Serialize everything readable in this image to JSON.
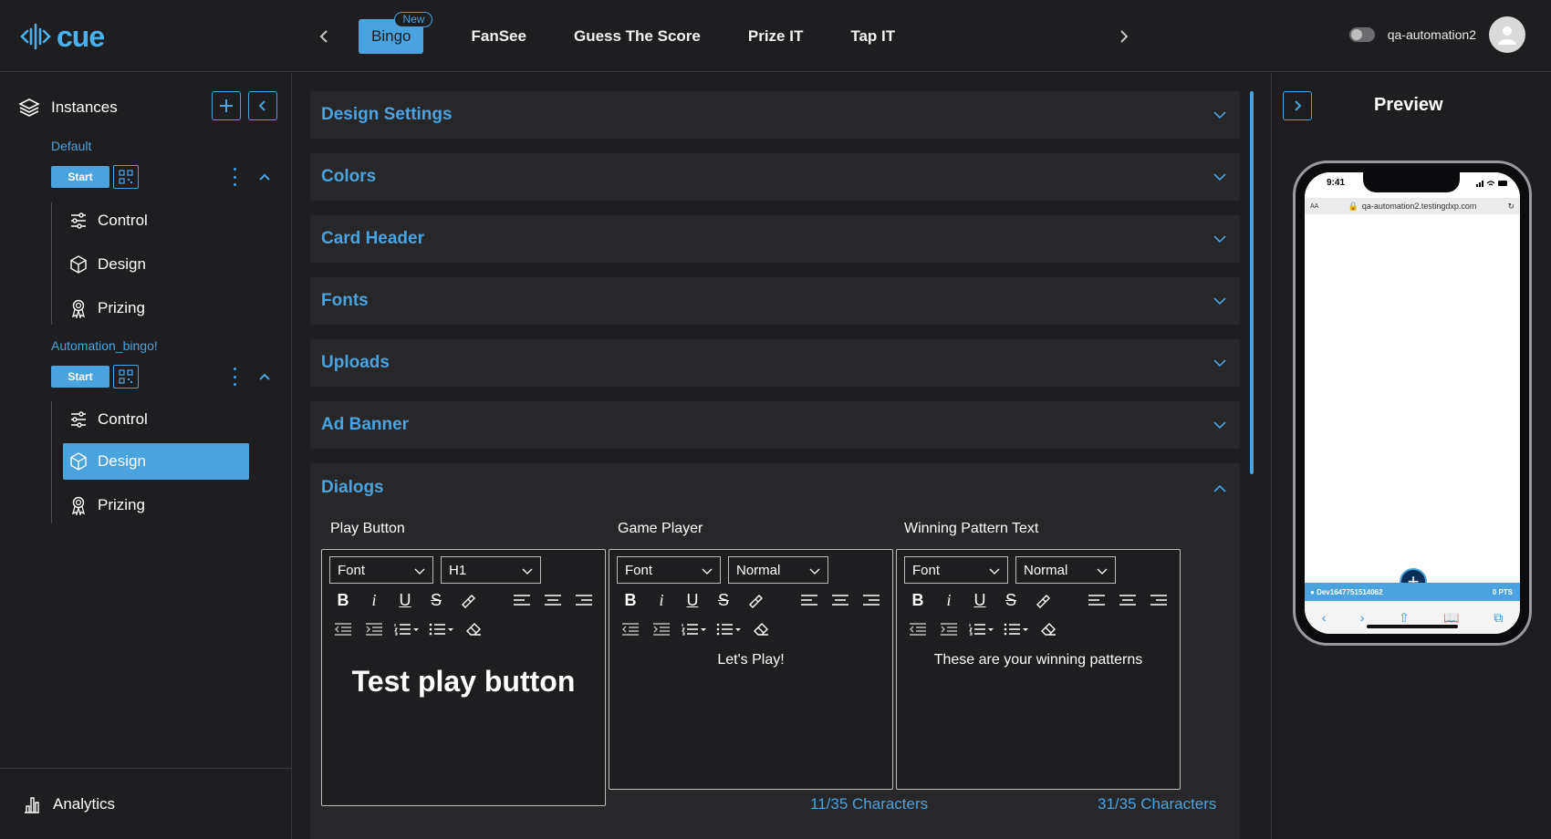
{
  "app": {
    "logo_text": "cue",
    "brand_color": "#4aa3df"
  },
  "topbar": {
    "tabs": [
      {
        "label": "Bingo",
        "badge": "New",
        "active": true
      },
      {
        "label": "FanSee"
      },
      {
        "label": "Guess The Score"
      },
      {
        "label": "Prize IT"
      },
      {
        "label": "Tap IT"
      }
    ],
    "username": "qa-automation2"
  },
  "sidebar": {
    "title": "Instances",
    "instances": [
      {
        "name": "Default",
        "start_label": "Start",
        "items": [
          "Control",
          "Design",
          "Prizing"
        ],
        "active_item": null
      },
      {
        "name": "Automation_bingo!",
        "start_label": "Start",
        "items": [
          "Control",
          "Design",
          "Prizing"
        ],
        "active_item": "Design"
      }
    ],
    "analytics_label": "Analytics"
  },
  "main": {
    "sections": [
      "Design Settings",
      "Colors",
      "Card Header",
      "Fonts",
      "Uploads",
      "Ad Banner"
    ],
    "dialogs": {
      "title": "Dialogs",
      "editors": [
        {
          "label": "Play Button",
          "font": "Font",
          "size": "H1",
          "content": "Test play button",
          "char_count": ""
        },
        {
          "label": "Game Player",
          "font": "Font",
          "size": "Normal",
          "content": "Let's Play!",
          "char_count": "11/35 Characters"
        },
        {
          "label": "Winning Pattern Text",
          "font": "Font",
          "size": "Normal",
          "content": "These are your winning patterns",
          "char_count": "31/35 Characters"
        }
      ]
    }
  },
  "preview": {
    "title": "Preview",
    "time": "9:41",
    "url": "qa-automation2.testingdxp.com",
    "strip_left": "Dev1647751514062",
    "strip_right": "0 PTS"
  }
}
